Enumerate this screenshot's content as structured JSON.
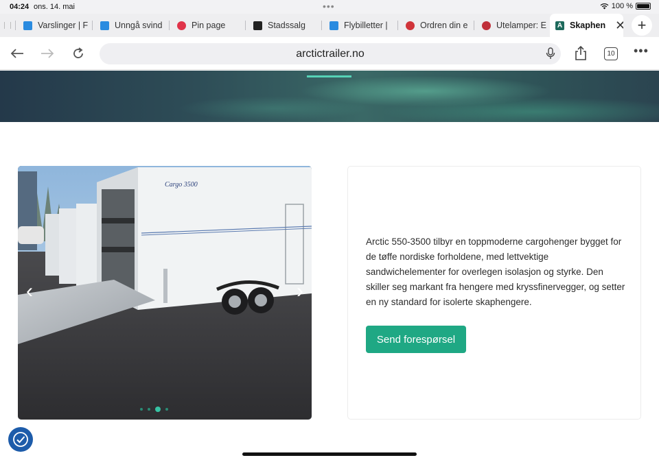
{
  "status": {
    "time": "04:24",
    "date": "ons. 14. mai",
    "battery": "100 %"
  },
  "tabs": [
    {
      "label": "Varslinger | F",
      "favicon_color": "#2a8be0"
    },
    {
      "label": "Unngå svind",
      "favicon_color": "#2a8be0"
    },
    {
      "label": "Pin page",
      "favicon_color": "#e0344a"
    },
    {
      "label": "Stadssalg",
      "favicon_color": "#222222"
    },
    {
      "label": "Flybilletter |",
      "favicon_color": "#2a8be0"
    },
    {
      "label": "Ordren din e",
      "favicon_color": "#d0343a"
    },
    {
      "label": "Utelamper: E",
      "favicon_color": "#c0303a"
    },
    {
      "label": "Skaphen",
      "favicon_color": "#1e6a5c",
      "active": true
    }
  ],
  "toolbar": {
    "url": "arctictrailer.no",
    "tab_count": "10"
  },
  "content": {
    "description": "Arctic 550-3500 tilbyr en toppmoderne cargohenger bygget for de tøffe nordiske forholdene, med lettvektige sandwichelementer for overlegen isolasjon og styrke. Den skiller seg markant fra hengere med kryssfinervegger, og setter en ny standard for isolerte skaphengere.",
    "cta_label": "Send forespørsel",
    "trailer_brand": "Cargo 3500",
    "slider": {
      "slides": 4,
      "active_index": 2
    }
  },
  "colors": {
    "accent": "#1fa884",
    "hero_line": "#56d3b7",
    "a11y": "#1d5caa"
  }
}
